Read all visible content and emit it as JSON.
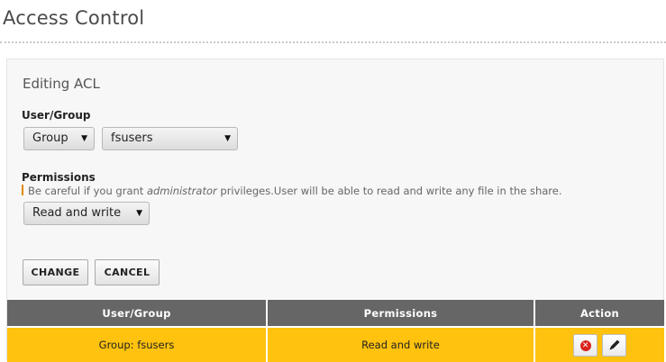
{
  "page": {
    "title": "Access Control"
  },
  "form": {
    "heading": "Editing ACL",
    "user_group_label": "User/Group",
    "type_select": {
      "selected": "Group"
    },
    "name_select": {
      "selected": "fsusers"
    },
    "permissions_label": "Permissions",
    "hint": {
      "before": "Be careful if you grant ",
      "emphasis": "administrator",
      "after": " privileges.User will be able to read and write any file in the share."
    },
    "permissions_select": {
      "selected": "Read and write"
    },
    "change_label": "CHANGE",
    "cancel_label": "CANCEL"
  },
  "table": {
    "headers": [
      "User/Group",
      "Permissions",
      "Action"
    ],
    "rows": [
      {
        "user_group": "Group: fsusers",
        "permissions": "Read and write"
      }
    ]
  },
  "icons": {
    "select_arrow": "caret-down-icon",
    "remove": "remove-circle-icon",
    "edit": "pencil-icon"
  },
  "colors": {
    "header_bg": "#666666",
    "highlight_row": "#ffc20e",
    "warning_accent": "#e08a00",
    "remove_red": "#d9251c"
  }
}
